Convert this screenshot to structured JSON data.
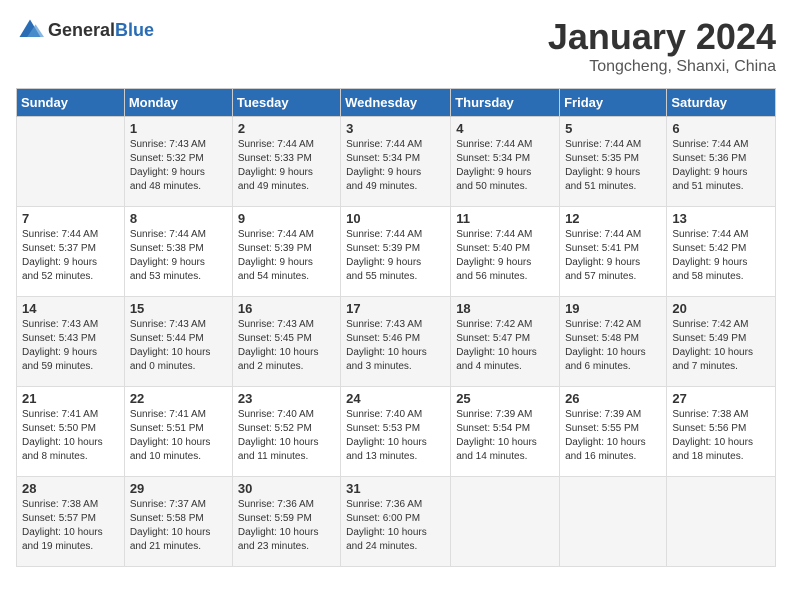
{
  "header": {
    "logo_general": "General",
    "logo_blue": "Blue",
    "title": "January 2024",
    "subtitle": "Tongcheng, Shanxi, China"
  },
  "days_of_week": [
    "Sunday",
    "Monday",
    "Tuesday",
    "Wednesday",
    "Thursday",
    "Friday",
    "Saturday"
  ],
  "weeks": [
    [
      {
        "day": "",
        "info": ""
      },
      {
        "day": "1",
        "info": "Sunrise: 7:43 AM\nSunset: 5:32 PM\nDaylight: 9 hours\nand 48 minutes."
      },
      {
        "day": "2",
        "info": "Sunrise: 7:44 AM\nSunset: 5:33 PM\nDaylight: 9 hours\nand 49 minutes."
      },
      {
        "day": "3",
        "info": "Sunrise: 7:44 AM\nSunset: 5:34 PM\nDaylight: 9 hours\nand 49 minutes."
      },
      {
        "day": "4",
        "info": "Sunrise: 7:44 AM\nSunset: 5:34 PM\nDaylight: 9 hours\nand 50 minutes."
      },
      {
        "day": "5",
        "info": "Sunrise: 7:44 AM\nSunset: 5:35 PM\nDaylight: 9 hours\nand 51 minutes."
      },
      {
        "day": "6",
        "info": "Sunrise: 7:44 AM\nSunset: 5:36 PM\nDaylight: 9 hours\nand 51 minutes."
      }
    ],
    [
      {
        "day": "7",
        "info": "Sunrise: 7:44 AM\nSunset: 5:37 PM\nDaylight: 9 hours\nand 52 minutes."
      },
      {
        "day": "8",
        "info": "Sunrise: 7:44 AM\nSunset: 5:38 PM\nDaylight: 9 hours\nand 53 minutes."
      },
      {
        "day": "9",
        "info": "Sunrise: 7:44 AM\nSunset: 5:39 PM\nDaylight: 9 hours\nand 54 minutes."
      },
      {
        "day": "10",
        "info": "Sunrise: 7:44 AM\nSunset: 5:39 PM\nDaylight: 9 hours\nand 55 minutes."
      },
      {
        "day": "11",
        "info": "Sunrise: 7:44 AM\nSunset: 5:40 PM\nDaylight: 9 hours\nand 56 minutes."
      },
      {
        "day": "12",
        "info": "Sunrise: 7:44 AM\nSunset: 5:41 PM\nDaylight: 9 hours\nand 57 minutes."
      },
      {
        "day": "13",
        "info": "Sunrise: 7:44 AM\nSunset: 5:42 PM\nDaylight: 9 hours\nand 58 minutes."
      }
    ],
    [
      {
        "day": "14",
        "info": "Sunrise: 7:43 AM\nSunset: 5:43 PM\nDaylight: 9 hours\nand 59 minutes."
      },
      {
        "day": "15",
        "info": "Sunrise: 7:43 AM\nSunset: 5:44 PM\nDaylight: 10 hours\nand 0 minutes."
      },
      {
        "day": "16",
        "info": "Sunrise: 7:43 AM\nSunset: 5:45 PM\nDaylight: 10 hours\nand 2 minutes."
      },
      {
        "day": "17",
        "info": "Sunrise: 7:43 AM\nSunset: 5:46 PM\nDaylight: 10 hours\nand 3 minutes."
      },
      {
        "day": "18",
        "info": "Sunrise: 7:42 AM\nSunset: 5:47 PM\nDaylight: 10 hours\nand 4 minutes."
      },
      {
        "day": "19",
        "info": "Sunrise: 7:42 AM\nSunset: 5:48 PM\nDaylight: 10 hours\nand 6 minutes."
      },
      {
        "day": "20",
        "info": "Sunrise: 7:42 AM\nSunset: 5:49 PM\nDaylight: 10 hours\nand 7 minutes."
      }
    ],
    [
      {
        "day": "21",
        "info": "Sunrise: 7:41 AM\nSunset: 5:50 PM\nDaylight: 10 hours\nand 8 minutes."
      },
      {
        "day": "22",
        "info": "Sunrise: 7:41 AM\nSunset: 5:51 PM\nDaylight: 10 hours\nand 10 minutes."
      },
      {
        "day": "23",
        "info": "Sunrise: 7:40 AM\nSunset: 5:52 PM\nDaylight: 10 hours\nand 11 minutes."
      },
      {
        "day": "24",
        "info": "Sunrise: 7:40 AM\nSunset: 5:53 PM\nDaylight: 10 hours\nand 13 minutes."
      },
      {
        "day": "25",
        "info": "Sunrise: 7:39 AM\nSunset: 5:54 PM\nDaylight: 10 hours\nand 14 minutes."
      },
      {
        "day": "26",
        "info": "Sunrise: 7:39 AM\nSunset: 5:55 PM\nDaylight: 10 hours\nand 16 minutes."
      },
      {
        "day": "27",
        "info": "Sunrise: 7:38 AM\nSunset: 5:56 PM\nDaylight: 10 hours\nand 18 minutes."
      }
    ],
    [
      {
        "day": "28",
        "info": "Sunrise: 7:38 AM\nSunset: 5:57 PM\nDaylight: 10 hours\nand 19 minutes."
      },
      {
        "day": "29",
        "info": "Sunrise: 7:37 AM\nSunset: 5:58 PM\nDaylight: 10 hours\nand 21 minutes."
      },
      {
        "day": "30",
        "info": "Sunrise: 7:36 AM\nSunset: 5:59 PM\nDaylight: 10 hours\nand 23 minutes."
      },
      {
        "day": "31",
        "info": "Sunrise: 7:36 AM\nSunset: 6:00 PM\nDaylight: 10 hours\nand 24 minutes."
      },
      {
        "day": "",
        "info": ""
      },
      {
        "day": "",
        "info": ""
      },
      {
        "day": "",
        "info": ""
      }
    ]
  ]
}
